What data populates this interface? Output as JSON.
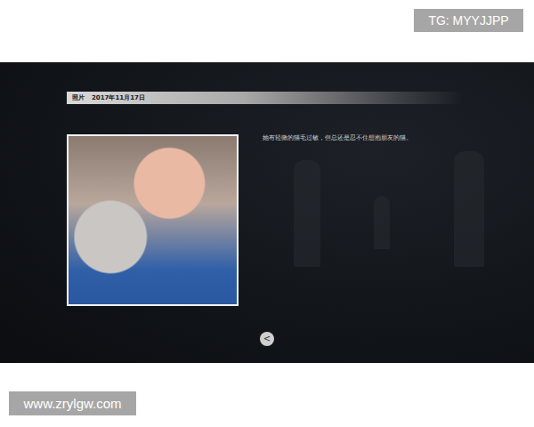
{
  "watermarks": {
    "top": "TG: MYYJJPP",
    "bottom": "www.zrylgw.com"
  },
  "header": {
    "label": "照片",
    "date": "2017年11月17日"
  },
  "entry": {
    "description": "她有轻微的猫毛过敏，但总还是忍不住想抱朋友的猫。"
  },
  "back_button": {
    "label": "<"
  }
}
